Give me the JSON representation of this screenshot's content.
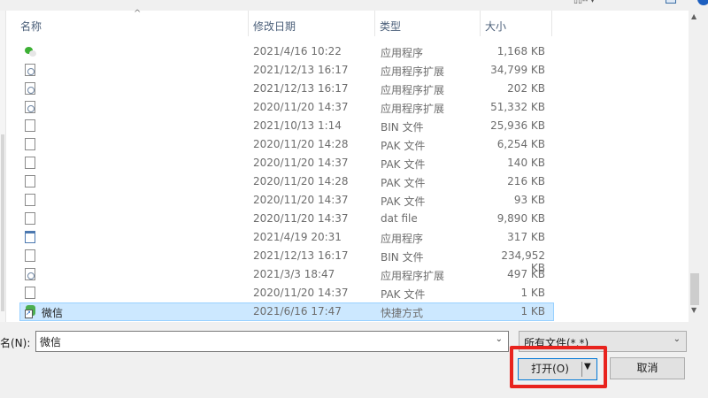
{
  "columns": {
    "name": "名称",
    "date": "修改日期",
    "type": "类型",
    "size": "大小"
  },
  "files": [
    {
      "icon": "wechat-icon",
      "name": "",
      "date": "2021/4/16 10:22",
      "type": "应用程序",
      "size": "1,168 KB"
    },
    {
      "icon": "extension-icon",
      "name": "",
      "date": "2021/12/13 16:17",
      "type": "应用程序扩展",
      "size": "34,799 KB"
    },
    {
      "icon": "extension-icon",
      "name": "",
      "date": "2021/12/13 16:17",
      "type": "应用程序扩展",
      "size": "202 KB"
    },
    {
      "icon": "extension-icon",
      "name": "",
      "date": "2020/11/20 14:37",
      "type": "应用程序扩展",
      "size": "51,332 KB"
    },
    {
      "icon": "document-icon",
      "name": "",
      "date": "2021/10/13 1:14",
      "type": "BIN 文件",
      "size": "25,936 KB"
    },
    {
      "icon": "document-icon",
      "name": "",
      "date": "2020/11/20 14:28",
      "type": "PAK 文件",
      "size": "6,254 KB"
    },
    {
      "icon": "document-icon",
      "name": "",
      "date": "2020/11/20 14:37",
      "type": "PAK 文件",
      "size": "140 KB"
    },
    {
      "icon": "document-icon",
      "name": "",
      "date": "2020/11/20 14:28",
      "type": "PAK 文件",
      "size": "216 KB"
    },
    {
      "icon": "document-icon",
      "name": "",
      "date": "2020/11/20 14:37",
      "type": "PAK 文件",
      "size": "93 KB"
    },
    {
      "icon": "document-icon",
      "name": "",
      "date": "2020/11/20 14:37",
      "type": "dat file",
      "size": "9,890 KB"
    },
    {
      "icon": "application-icon",
      "name": "",
      "date": "2021/4/19 20:31",
      "type": "应用程序",
      "size": "317 KB"
    },
    {
      "icon": "document-icon",
      "name": "",
      "date": "2021/12/13 16:17",
      "type": "BIN 文件",
      "size": "234,952 KB"
    },
    {
      "icon": "extension-icon",
      "name": "",
      "date": "2021/3/3 18:47",
      "type": "应用程序扩展",
      "size": "497 KB"
    },
    {
      "icon": "document-icon",
      "name": "",
      "date": "2020/11/20 14:37",
      "type": "PAK 文件",
      "size": "1 KB"
    },
    {
      "icon": "shortcut-icon",
      "name": "微信",
      "date": "2021/6/16 17:47",
      "type": "快捷方式",
      "size": "1 KB",
      "selected": true
    }
  ],
  "filename": {
    "label": "名(N):",
    "value": "微信"
  },
  "filetype": {
    "value": "所有文件(*.*)"
  },
  "buttons": {
    "open": "打开(O)",
    "cancel": "取消"
  },
  "colors": {
    "selection": "#cce8ff",
    "highlight": "#e8231e",
    "accent": "#0078d7"
  }
}
